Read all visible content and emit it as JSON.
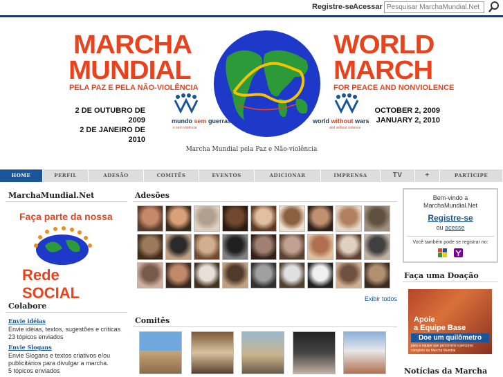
{
  "topbar": {
    "register_label": "Registre-se",
    "login_label": "Acessar",
    "search_placeholder": "Pesquisar MarchaMundial.Net"
  },
  "banner": {
    "pt_title_1": "MARCHA",
    "pt_title_2": "MUNDIAL",
    "pt_subtitle": "PELA PAZ E PELA NÃO-VIOLÊNCIA",
    "pt_date_1": "2 DE OUTUBRO DE 2009",
    "pt_date_2": "2 DE JANEIRO DE 2010",
    "pt_brand_a": "mundo ",
    "pt_brand_b": "sem",
    "pt_brand_c": " guerras",
    "pt_brand_small": "e sem violência",
    "en_title_1": "WORLD",
    "en_title_2": "MARCH",
    "en_subtitle": "FOR PEACE AND NONVIOLENCE",
    "en_date_1": "OCTOBER 2, 2009",
    "en_date_2": "JANUARY 2, 2010",
    "en_brand_a": "world ",
    "en_brand_b": "without",
    "en_brand_c": " wars",
    "en_brand_small": "and without violence",
    "caption": "Marcha Mundial pela Paz e Não-violência"
  },
  "nav": [
    {
      "label": "Home",
      "active": true
    },
    {
      "label": "Perfil"
    },
    {
      "label": "Adesão"
    },
    {
      "label": "Comitês"
    },
    {
      "label": "Eventos"
    },
    {
      "label": "Adicionar"
    },
    {
      "label": "Imprensa"
    },
    {
      "label": "TV"
    },
    {
      "label": "+"
    },
    {
      "label": "Participe"
    }
  ],
  "left": {
    "site_title": "MarchaMundial.Net",
    "social_line1": "Faça parte da nossa",
    "social_line2_a": "Rede ",
    "social_line2_b": "SOCIAL",
    "colabore_title": "Colabore",
    "ideas_link": "Envie idéias",
    "ideas_desc": "Envie idéias, textos, sugestões e críticas",
    "ideas_count": "23 tópicos enviados",
    "slogans_link": "Envie Slogans",
    "slogans_desc_1": "Envie Slogans e textos criativos e/ou",
    "slogans_desc_2": "publicitários para divulgar a marcha.",
    "slogans_count": "5 tópicos enviados"
  },
  "center": {
    "adesoes_title": "Adesões",
    "view_all": "Exibir todos",
    "comites_title": "Comitês"
  },
  "right": {
    "welcome_1": "Bem-vindo a",
    "welcome_2": "MarchaMundial.Net",
    "register": "Registre-se",
    "or": "ou",
    "access": "acesse",
    "also": "Você também pode se registrar no:",
    "donation_title": "Faça uma Doação",
    "donate_line1": "Apoie",
    "donate_line2": "a Equipe Base",
    "donate_line3": "Doe um quilômetro",
    "donate_line4": "para a equipe que percorrerá o percurso",
    "donate_line5": "completo da Marcha Mundial",
    "news_title": "Notícias da Marcha"
  },
  "colors": {
    "brand_red": "#e8431d",
    "navy": "#1a3c6e",
    "link_blue": "#1a5599"
  }
}
